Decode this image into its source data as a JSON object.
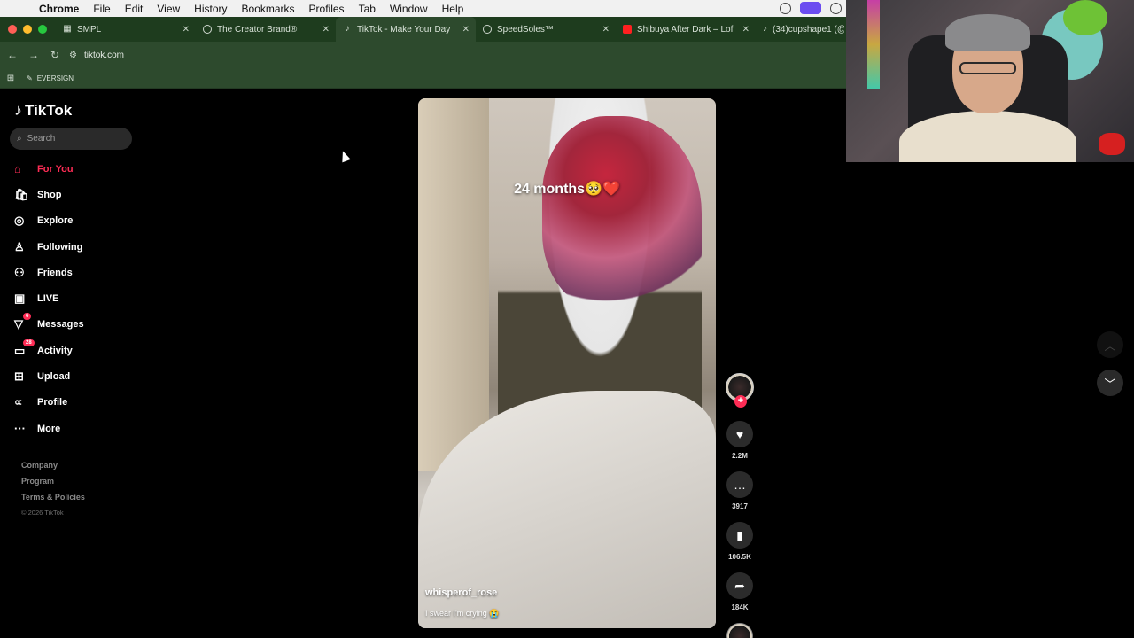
{
  "menubar": {
    "apple": "",
    "app": "Chrome",
    "items": [
      "File",
      "Edit",
      "View",
      "History",
      "Bookmarks",
      "Profiles",
      "Tab",
      "Window",
      "Help"
    ]
  },
  "tabs": [
    {
      "title": "SMPL",
      "active": false
    },
    {
      "title": "The Creator Brand®",
      "active": false
    },
    {
      "title": "TikTok - Make Your Day",
      "active": true
    },
    {
      "title": "SpeedSoles™",
      "active": false
    },
    {
      "title": "Shibuya After Dark – Lofi Rai",
      "active": false
    },
    {
      "title": "(34)cupshape1 (@cup",
      "active": false
    }
  ],
  "address": {
    "url": "tiktok.com"
  },
  "bookmarks": {
    "item": "EVERSIGN"
  },
  "tiktok": {
    "logo": "TikTok",
    "search_placeholder": "Search",
    "nav": [
      {
        "label": "For You",
        "icon": "home-icon",
        "active": true
      },
      {
        "label": "Shop",
        "icon": "shop-icon"
      },
      {
        "label": "Explore",
        "icon": "compass-icon"
      },
      {
        "label": "Following",
        "icon": "following-icon"
      },
      {
        "label": "Friends",
        "icon": "friends-icon"
      },
      {
        "label": "LIVE",
        "icon": "live-icon"
      },
      {
        "label": "Messages",
        "icon": "messages-icon",
        "badge": "6"
      },
      {
        "label": "Activity",
        "icon": "activity-icon",
        "badge": "28"
      },
      {
        "label": "Upload",
        "icon": "upload-icon"
      },
      {
        "label": "Profile",
        "icon": "profile-icon"
      },
      {
        "label": "More",
        "icon": "more-icon"
      }
    ],
    "footer": {
      "company": "Company",
      "program": "Program",
      "terms": "Terms & Policies",
      "copyright": "© 2026 TikTok"
    }
  },
  "video": {
    "overlay_text": "24 months🥺❤️",
    "username": "whisperof_rose",
    "description": "I swear I'm crying 😭",
    "likes": "2.2M",
    "comments": "3917",
    "saves": "106.5K",
    "shares": "184K"
  },
  "colors": {
    "accent": "#fe2c55",
    "chrome_bar": "#2d4a2d"
  }
}
